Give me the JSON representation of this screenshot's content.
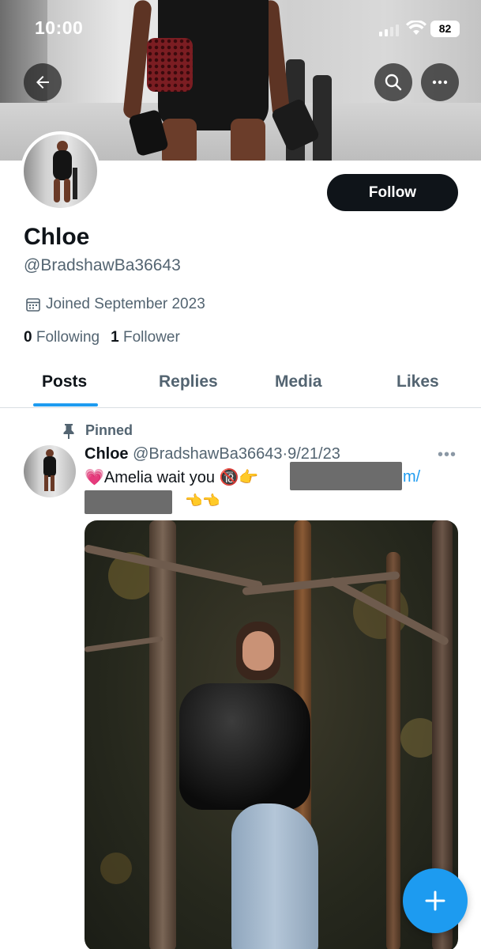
{
  "status_bar": {
    "time": "10:00",
    "battery": "82"
  },
  "profile": {
    "display_name": "Chloe",
    "handle": "@BradshawBa36643",
    "joined": "Joined September 2023",
    "following_count": "0",
    "following_label": "Following",
    "followers_count": "1",
    "followers_label": "Follower",
    "follow_button": "Follow"
  },
  "tabs": [
    {
      "label": "Posts",
      "active": true
    },
    {
      "label": "Replies",
      "active": false
    },
    {
      "label": "Media",
      "active": false
    },
    {
      "label": "Likes",
      "active": false
    }
  ],
  "post": {
    "pinned_label": "Pinned",
    "author_name": "Chloe",
    "author_handle": "@BradshawBa36643",
    "date": "9/21/23",
    "text_before": "💗Amelia  wait you 🔞👉",
    "link_fragment": "m/",
    "text_after": "👈👈"
  },
  "icons": {
    "back": "back-arrow-icon",
    "search": "search-icon",
    "more": "more-icon",
    "calendar": "calendar-icon",
    "pin": "pin-icon",
    "compose": "plus-icon"
  },
  "colors": {
    "accent": "#1d9bf0",
    "text": "#0f1419",
    "muted": "#536471"
  }
}
